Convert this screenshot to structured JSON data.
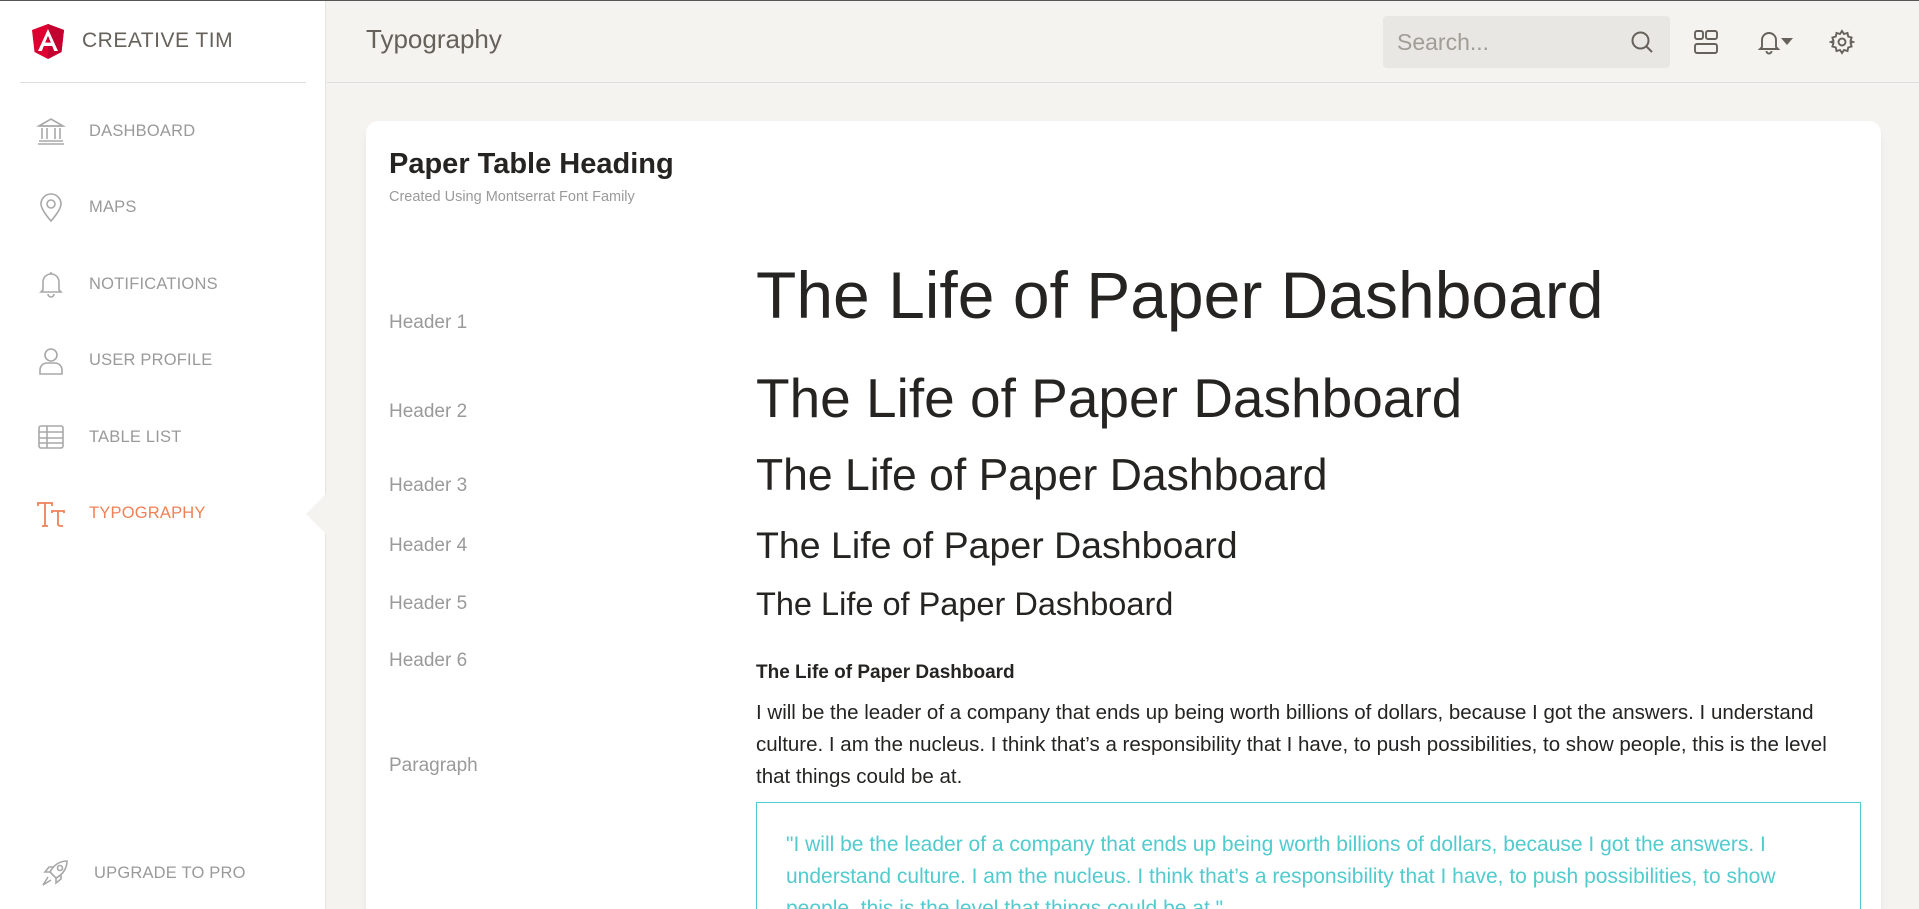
{
  "colors": {
    "accent": "#ef8157",
    "info": "#51cbce",
    "logo_red": "#dd0031",
    "muted": "#9a9a9a"
  },
  "sidebar": {
    "brand": {
      "logo_icon": "angular-logo",
      "name": "CREATIVE TIM"
    },
    "items": [
      {
        "label": "DASHBOARD",
        "icon": "bank-icon",
        "active": false
      },
      {
        "label": "MAPS",
        "icon": "map-pin-icon",
        "active": false
      },
      {
        "label": "NOTIFICATIONS",
        "icon": "bell-icon",
        "active": false
      },
      {
        "label": "USER PROFILE",
        "icon": "user-icon",
        "active": false
      },
      {
        "label": "TABLE LIST",
        "icon": "table-icon",
        "active": false
      },
      {
        "label": "TYPOGRAPHY",
        "icon": "typography-icon",
        "active": true
      }
    ],
    "upgrade": {
      "label": "UPGRADE TO PRO",
      "icon": "rocket-icon"
    }
  },
  "navbar": {
    "title": "Typography",
    "search": {
      "placeholder": "Search...",
      "value": ""
    },
    "icons": [
      "search-icon",
      "dashboard-icon",
      "bell-icon",
      "gear-icon"
    ]
  },
  "card": {
    "title": "Paper Table Heading",
    "subtitle": "Created Using Montserrat Font Family",
    "rows": [
      {
        "label": "Header 1",
        "sample": "The Life of Paper Dashboard"
      },
      {
        "label": "Header 2",
        "sample": "The Life of Paper Dashboard"
      },
      {
        "label": "Header 3",
        "sample": "The Life of Paper Dashboard"
      },
      {
        "label": "Header 4",
        "sample": "The Life of Paper Dashboard"
      },
      {
        "label": "Header 5",
        "sample": "The Life of Paper Dashboard"
      },
      {
        "label": "Header 6",
        "sample": "The Life of Paper Dashboard"
      }
    ],
    "paragraph": {
      "label": "Paragraph",
      "text": "I will be the leader of a company that ends up being worth billions of dollars, because I got the answers. I understand culture. I am the nucleus. I think that’s a responsibility that I have, to push possibilities, to show people, this is the level that things could be at."
    },
    "quote": {
      "text": "\"I will be the leader of a company that ends up being worth billions of dollars, because I got the answers. I understand culture. I am the nucleus. I think that’s a responsibility that I have, to push possibilities, to show people, this is the level that things could be at.\""
    }
  }
}
